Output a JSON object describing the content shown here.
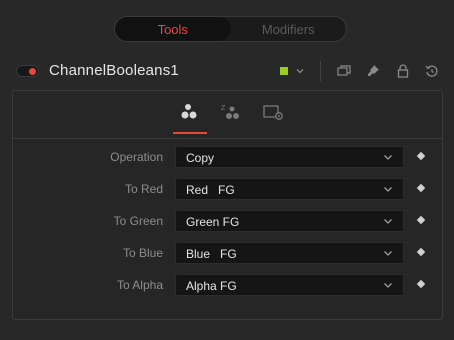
{
  "top_switch": {
    "tools_label": "Tools",
    "modifiers_label": "Modifiers"
  },
  "header": {
    "tool_name": "ChannelBooleans1",
    "swatch_color": "#9acd23",
    "icons": [
      "color-dropdown-icon",
      "window-icon",
      "pin-icon",
      "lock-icon",
      "reset-icon"
    ]
  },
  "tabs": [
    "channels-tab",
    "z-channels-tab",
    "settings-tab"
  ],
  "rows": [
    {
      "label": "Operation",
      "value": "Copy"
    },
    {
      "label": "To Red",
      "value": "Red   FG"
    },
    {
      "label": "To Green",
      "value": "Green FG"
    },
    {
      "label": "To Blue",
      "value": "Blue   FG"
    },
    {
      "label": "To Alpha",
      "value": "Alpha FG"
    }
  ],
  "colors": {
    "accent": "#e8483c",
    "swatch": "#9acd23"
  }
}
